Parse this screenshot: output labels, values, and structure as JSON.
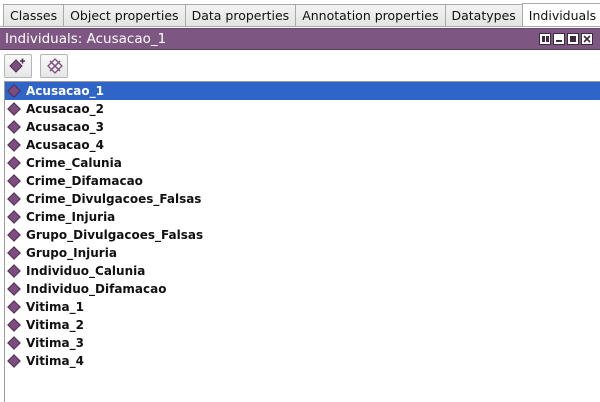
{
  "tabs": [
    {
      "label": "Classes",
      "active": false
    },
    {
      "label": "Object properties",
      "active": false
    },
    {
      "label": "Data properties",
      "active": false
    },
    {
      "label": "Annotation properties",
      "active": false
    },
    {
      "label": "Datatypes",
      "active": false
    },
    {
      "label": "Individuals",
      "active": true
    }
  ],
  "view": {
    "title": "Individuals: Acusacao_1",
    "header_color": "#7e5682",
    "controls": [
      "view-split-icon",
      "view-minimize-icon",
      "view-maximize-icon",
      "view-close-icon"
    ]
  },
  "toolbar": {
    "add_icon": "add-individual-icon",
    "delete_icon": "delete-individual-icon"
  },
  "individuals": {
    "selected_index": 0,
    "selection_color": "#2f65c9",
    "icon": "individual-diamond-icon",
    "icon_color": "#7c4d7e",
    "items": [
      "Acusacao_1",
      "Acusacao_2",
      "Acusacao_3",
      "Acusacao_4",
      "Crime_Calunia",
      "Crime_Difamacao",
      "Crime_Divulgacoes_Falsas",
      "Crime_Injuria",
      "Grupo_Divulgacoes_Falsas",
      "Grupo_Injuria",
      "Individuo_Calunia",
      "Individuo_Difamacao",
      "Vitima_1",
      "Vitima_2",
      "Vitima_3",
      "Vitima_4"
    ]
  }
}
